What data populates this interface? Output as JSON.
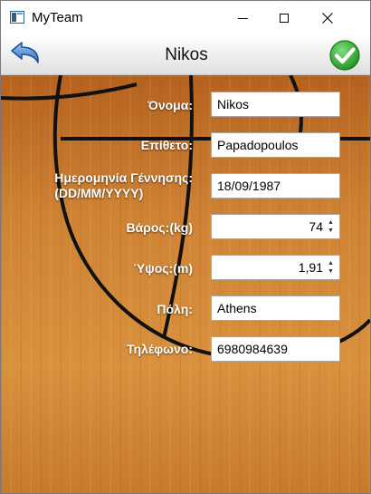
{
  "window": {
    "app_title": "MyTeam"
  },
  "header": {
    "title": "Nikos"
  },
  "form": {
    "first_name": {
      "label": "Όνομα:",
      "value": "Nikos"
    },
    "last_name": {
      "label": "Επίθετο:",
      "value": "Papadopoulos"
    },
    "birth_date": {
      "label_line1": "Ημερομηνία Γέννησης:",
      "label_line2": "(DD/MM/YYYY)",
      "value": "18/09/1987"
    },
    "weight": {
      "label": "Βάρος:(kg)",
      "value": "74"
    },
    "height": {
      "label": "Ύψος:(m)",
      "value": "1,91"
    },
    "city": {
      "label": "Πόλη:",
      "value": "Athens"
    },
    "phone": {
      "label": "Τηλέφωνο:",
      "value": "6980984639"
    }
  },
  "icons": {
    "app": "app-window-icon",
    "back": "back-arrow-icon",
    "confirm": "checkmark-icon",
    "spin_up": "▲",
    "spin_down": "▼"
  },
  "colors": {
    "wood": "#c8782e",
    "court_line": "#111111",
    "confirm_green": "#2fa52f",
    "back_blue": "#3d7fd1"
  }
}
